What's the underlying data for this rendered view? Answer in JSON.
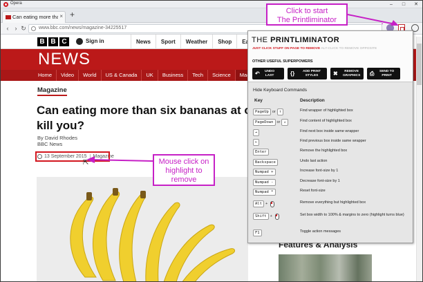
{
  "browser": {
    "app_name": "Opera",
    "tab_title": "Can eating more than six b",
    "new_tab": "+",
    "url": "www.bbc.com/news/magazine-34225517"
  },
  "bbc": {
    "blocks": [
      "B",
      "B",
      "C"
    ],
    "sign_in": "Sign in",
    "top_nav": [
      "News",
      "Sport",
      "Weather",
      "Shop",
      "Earth"
    ],
    "news_word": "NEWS",
    "sub_nav": [
      "Home",
      "Video",
      "World",
      "US & Canada",
      "UK",
      "Business",
      "Tech",
      "Science",
      "Magazi"
    ],
    "section": "Magazine",
    "headline_line1": "Can eating more than six bananas at on",
    "headline_line2": "kill you?",
    "byline_name": "By David Rhodes",
    "byline_org": "BBC News",
    "date": "13 September 2015",
    "date_section": "Magazine",
    "features_title": "Features & Analysis"
  },
  "printliminator": {
    "title_light": "THE ",
    "title_bold": "PRINTLIMINATOR",
    "subtitle_main": "JUST CLICK STUFF ON PAGE TO REMOVE",
    "subtitle_alt": "ALT-CLICK TO REMOVE OPPOSITE",
    "powers_label": "OTHER USEFUL SUPERPOWERS",
    "buttons": [
      {
        "icon": "undo-icon",
        "glyph": "↶",
        "line1": "UNDO",
        "line2": "LAST"
      },
      {
        "icon": "add-styles-icon",
        "glyph": "{}",
        "line1": "ADD PRINT",
        "line2": "STYLES"
      },
      {
        "icon": "remove-graphics-icon",
        "glyph": "✖",
        "line1": "REMOVE",
        "line2": "GRAPHICS"
      },
      {
        "icon": "print-icon",
        "glyph": "⎙",
        "line1": "SEND TO",
        "line2": "PRINT"
      }
    ],
    "hide_commands": "Hide Keyboard Commands",
    "col_key": "Key",
    "col_desc": "Description",
    "commands": [
      {
        "keys": [
          "PageUp"
        ],
        "sep": "or",
        "keys2": [
          "↑"
        ],
        "mouse": false,
        "desc": "Find wrapper of highlighted box"
      },
      {
        "keys": [
          "PageDown"
        ],
        "sep": "or",
        "keys2": [
          "↓"
        ],
        "mouse": false,
        "desc": "Find content of highlighted box"
      },
      {
        "keys": [
          "→"
        ],
        "sep": "",
        "keys2": [],
        "mouse": false,
        "desc": "Find next box inside same wrapper"
      },
      {
        "keys": [
          "←"
        ],
        "sep": "",
        "keys2": [],
        "mouse": false,
        "desc": "Find previous box inside same wrapper"
      },
      {
        "keys": [
          "Enter"
        ],
        "sep": "",
        "keys2": [],
        "mouse": false,
        "desc": "Remove the highlighted box"
      },
      {
        "keys": [
          "Backspace"
        ],
        "sep": "",
        "keys2": [],
        "mouse": false,
        "desc": "Undo last action"
      },
      {
        "keys": [
          "Numpad +"
        ],
        "sep": "",
        "keys2": [],
        "mouse": false,
        "desc": "Increase font-size by 1"
      },
      {
        "keys": [
          "Numpad -"
        ],
        "sep": "",
        "keys2": [],
        "mouse": false,
        "desc": "Decrease font-size by 1"
      },
      {
        "keys": [
          "Numpad *"
        ],
        "sep": "",
        "keys2": [],
        "mouse": false,
        "desc": "Reset font-size"
      },
      {
        "keys": [
          "Alt"
        ],
        "sep": "+",
        "keys2": [],
        "mouse": true,
        "desc": "Remove everything but highlighted box"
      },
      {
        "keys": [
          "Shift"
        ],
        "sep": "+",
        "keys2": [],
        "mouse": true,
        "desc": "Set box width to 100% & margins to zero (highlight turns blue)"
      },
      {
        "keys": [
          "F1"
        ],
        "sep": "",
        "keys2": [],
        "mouse": false,
        "desc": "Toggle action messages"
      }
    ]
  },
  "callouts": {
    "start_line1": "Click to start",
    "start_line2": "The Printliminator",
    "mouse_line1": "Mouse click on",
    "mouse_line2": "highlight to",
    "mouse_line3": "remove"
  },
  "colors": {
    "bbc_red": "#bb1919",
    "callout_magenta": "#c620c6",
    "highlight_red": "#d2161e"
  }
}
